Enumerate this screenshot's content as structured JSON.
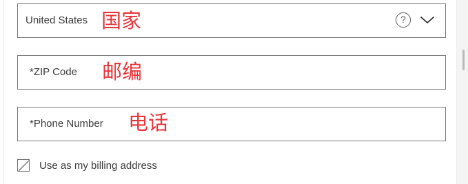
{
  "form": {
    "country": {
      "value": "United States",
      "annotation": "国家",
      "help_icon": "question-circle-icon",
      "help_glyph": "?",
      "dropdown_icon": "chevron-down-icon"
    },
    "zip": {
      "placeholder": "*ZIP Code",
      "annotation": "邮编"
    },
    "phone": {
      "placeholder": "*Phone Number",
      "annotation": "电话"
    },
    "billing_checkbox": {
      "label": "Use as my billing address",
      "checked": false
    }
  },
  "colors": {
    "annotation": "#e8353a",
    "field_border": "#7a7a7a",
    "text": "#3b3b3b"
  }
}
